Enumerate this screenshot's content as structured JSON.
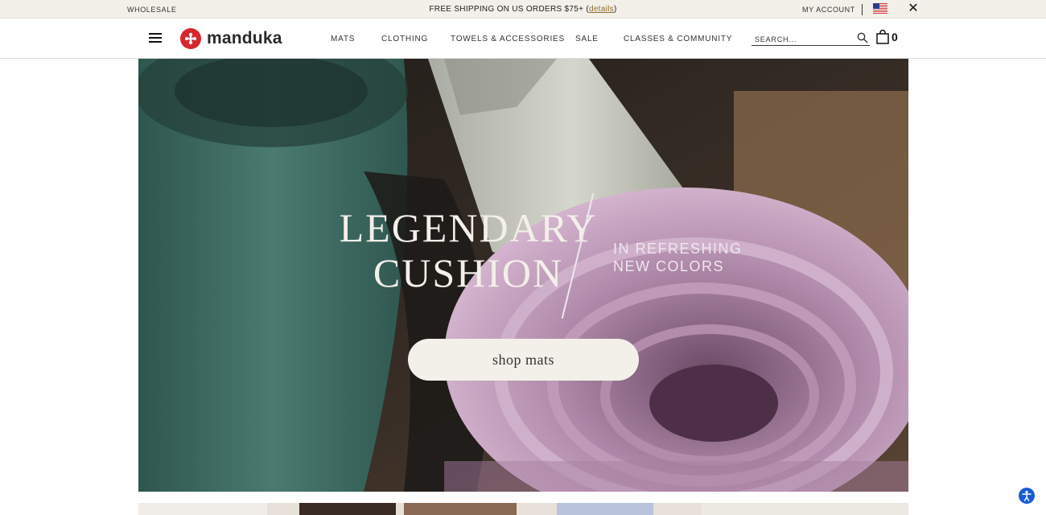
{
  "topbar": {
    "wholesale": "WHOLESALE",
    "shipping_text": "FREE SHIPPING ON US ORDERS $75+ (",
    "shipping_link": "details",
    "shipping_end": ")",
    "account": "MY ACCOUNT",
    "close": "✕"
  },
  "header": {
    "logo_text": "manduka",
    "nav": [
      "MATS",
      "CLOTHING",
      "TOWELS & ACCESSORIES",
      "SALE",
      "CLASSES & COMMUNITY"
    ],
    "search_placeholder": "SEARCH...",
    "cart_count": "0"
  },
  "hero": {
    "headline_1": "LEGENDARY",
    "headline_2": "CUSHION",
    "subline_1": "IN REFRESHING",
    "subline_2": "NEW COLORS",
    "cta": "shop mats"
  },
  "colors": {
    "topbar_bg": "#f3efe9",
    "brand_red": "#d7272d",
    "mat_green": "#3f6b62",
    "mat_lilac": "#c9a6c4",
    "mat_gray": "#c9c9bf"
  }
}
